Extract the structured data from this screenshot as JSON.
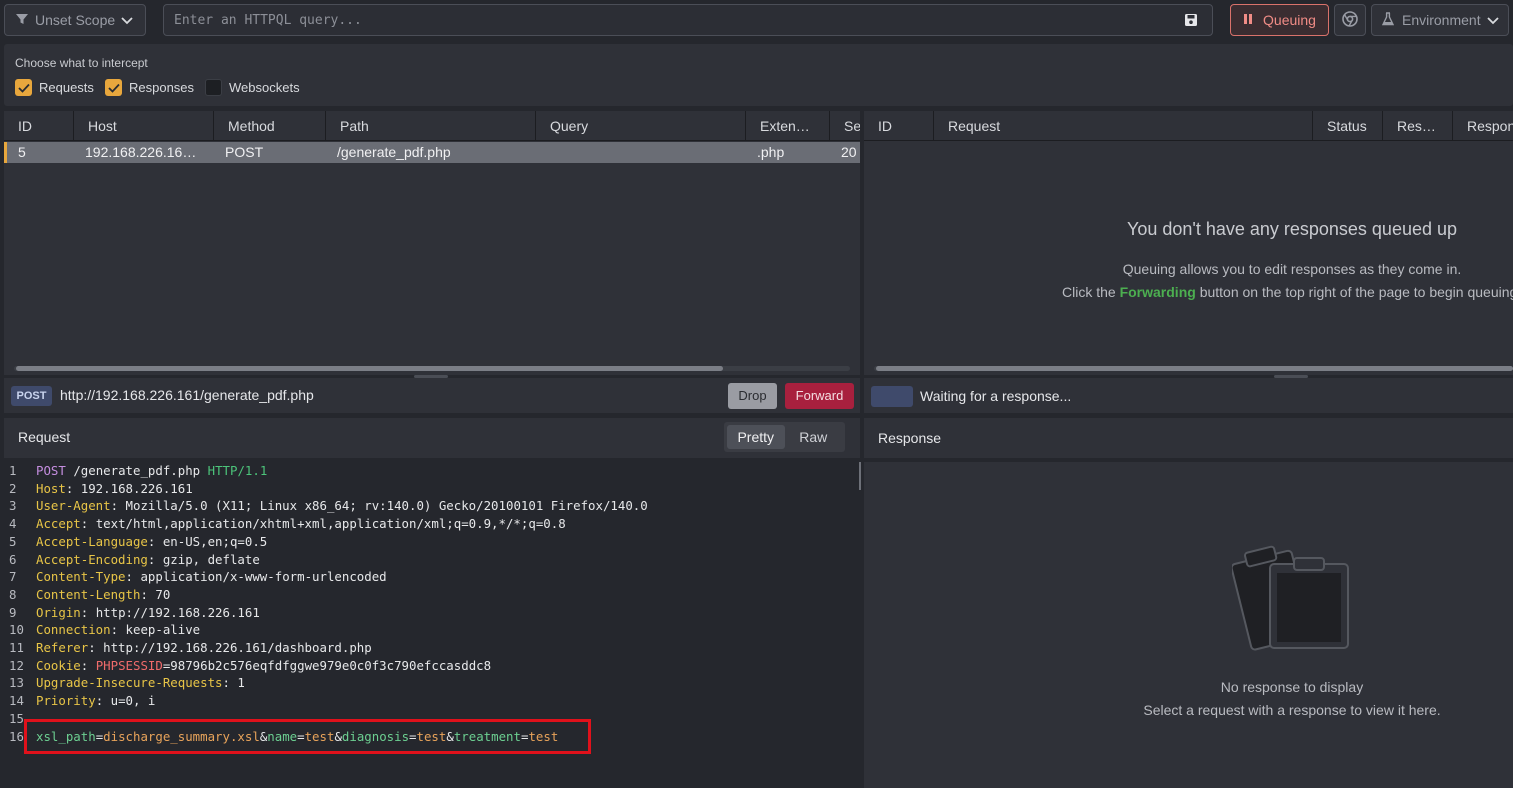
{
  "topbar": {
    "scope_label": "Unset Scope",
    "query_placeholder": "Enter an HTTPQL query...",
    "queuing_label": "Queuing",
    "environment_label": "Environment"
  },
  "intercept": {
    "title": "Choose what to intercept",
    "options": [
      {
        "label": "Requests",
        "checked": true
      },
      {
        "label": "Responses",
        "checked": true
      },
      {
        "label": "Websockets",
        "checked": false
      }
    ]
  },
  "request_queue": {
    "columns": [
      "ID",
      "Host",
      "Method",
      "Path",
      "Query",
      "Exten…",
      "Se"
    ],
    "rows": [
      {
        "id": "5",
        "host": "192.168.226.16…",
        "method": "POST",
        "path": "/generate_pdf.php",
        "query": "",
        "extension": ".php",
        "se": "20"
      }
    ]
  },
  "response_queue": {
    "columns": [
      "ID",
      "Request",
      "Status",
      "Res…",
      "Respon"
    ],
    "empty_title": "You don't have any responses queued up",
    "empty_line1": "Queuing allows you to edit responses as they come in.",
    "empty_line2_pre": "Click the ",
    "empty_line2_link": "Forwarding",
    "empty_line2_post": " button on the top right of the page to begin queuing"
  },
  "request_bar": {
    "method": "POST",
    "url": "http://192.168.226.161/generate_pdf.php",
    "drop_label": "Drop",
    "forward_label": "Forward"
  },
  "response_bar": {
    "waiting_text": "Waiting for a response..."
  },
  "request_pane": {
    "title": "Request",
    "view_options": [
      "Pretty",
      "Raw"
    ],
    "active_view": "Pretty",
    "request_line": {
      "method": "POST",
      "path": "/generate_pdf.php",
      "version": "HTTP/1.1"
    },
    "headers": [
      {
        "name": "Host",
        "value": "192.168.226.161"
      },
      {
        "name": "User-Agent",
        "value": "Mozilla/5.0 (X11; Linux x86_64; rv:140.0) Gecko/20100101 Firefox/140.0"
      },
      {
        "name": "Accept",
        "value": "text/html,application/xhtml+xml,application/xml;q=0.9,*/*;q=0.8"
      },
      {
        "name": "Accept-Language",
        "value": "en-US,en;q=0.5"
      },
      {
        "name": "Accept-Encoding",
        "value": "gzip, deflate"
      },
      {
        "name": "Content-Type",
        "value": "application/x-www-form-urlencoded"
      },
      {
        "name": "Content-Length",
        "value": "70"
      },
      {
        "name": "Origin",
        "value": "http://192.168.226.161"
      },
      {
        "name": "Connection",
        "value": "keep-alive"
      },
      {
        "name": "Referer",
        "value": "http://192.168.226.161/dashboard.php"
      },
      {
        "name": "Cookie",
        "cookie_name": "PHPSESSID",
        "cookie_value": "98796b2c576eqfdfggwe979e0c0f3c790efccasddc8"
      },
      {
        "name": "Upgrade-Insecure-Requests",
        "value": "1"
      },
      {
        "name": "Priority",
        "value": "u=0, i"
      }
    ],
    "body_params": [
      {
        "key": "xsl_path",
        "value": "discharge_summary.xsl"
      },
      {
        "key": "name",
        "value": "test"
      },
      {
        "key": "diagnosis",
        "value": "test"
      },
      {
        "key": "treatment",
        "value": "test"
      }
    ]
  },
  "response_pane": {
    "title": "Response",
    "empty_title": "No response to display",
    "empty_subtitle": "Select a request with a response to view it here."
  },
  "colors": {
    "accent_orange": "#e8a73d",
    "queuing_red": "#f08c86",
    "forward_red": "#a8203e",
    "forwarding_link": "#4caf50",
    "highlight_box": "#e0111b"
  }
}
